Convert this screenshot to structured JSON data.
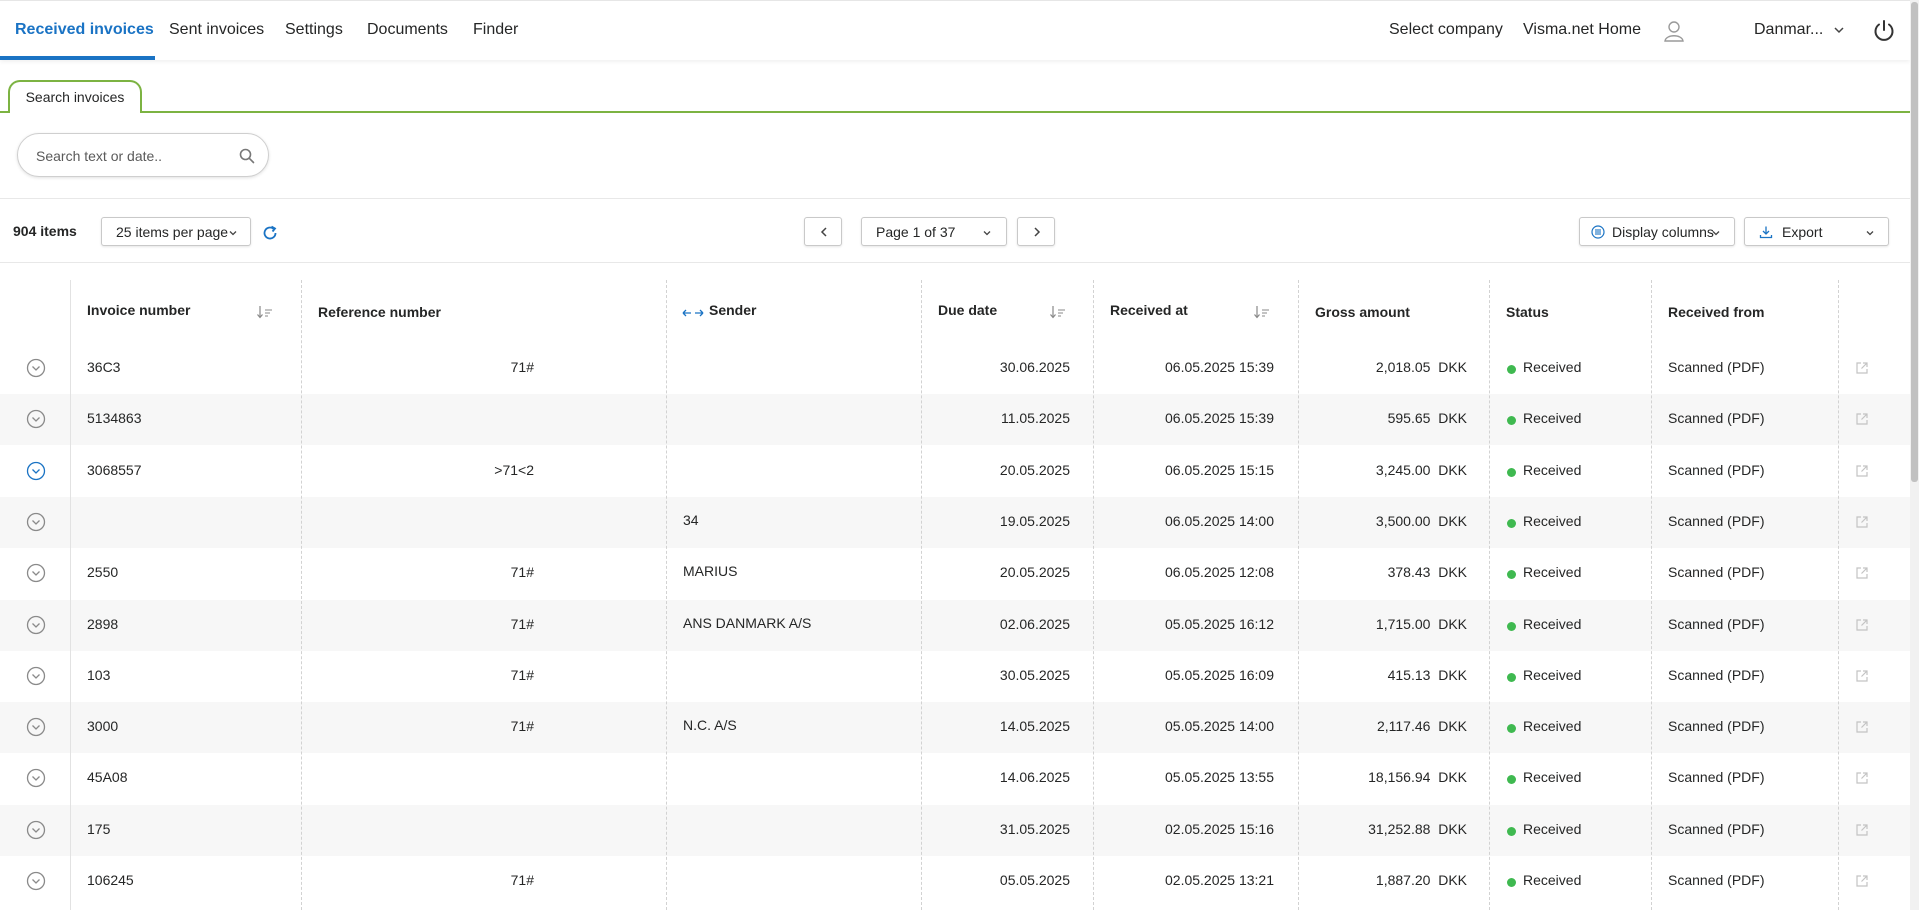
{
  "nav": {
    "left": [
      "Received invoices",
      "Sent invoices",
      "Settings",
      "Documents",
      "Finder"
    ],
    "select_company": "Select company",
    "home": "Visma.net Home",
    "country": "Danmar..."
  },
  "tab": {
    "label": "Search invoices"
  },
  "search": {
    "placeholder": "Search text or date.."
  },
  "toolbar": {
    "items_count": "904 items",
    "per_page": "25 items per page",
    "page_label": "Page 1 of 37",
    "display_columns": "Display columns",
    "export": "Export"
  },
  "columns": [
    "Invoice number",
    "Reference number",
    "Sender",
    "Due date",
    "Received at",
    "Gross amount",
    "Status",
    "Received from"
  ],
  "rows": [
    {
      "invoice": "36C3",
      "reference": "71#",
      "sender": "",
      "due": "30.06.2025",
      "received": "06.05.2025 15:39",
      "amount": "2,018.05",
      "currency": "DKK",
      "status": "Received",
      "from": "Scanned (PDF)",
      "expanded": false
    },
    {
      "invoice": "5134863",
      "reference": "",
      "sender": "",
      "due": "11.05.2025",
      "received": "06.05.2025 15:39",
      "amount": "595.65",
      "currency": "DKK",
      "status": "Received",
      "from": "Scanned (PDF)",
      "expanded": false
    },
    {
      "invoice": "3068557",
      "reference": ">71<2",
      "sender": "",
      "due": "20.05.2025",
      "received": "06.05.2025 15:15",
      "amount": "3,245.00",
      "currency": "DKK",
      "status": "Received",
      "from": "Scanned (PDF)",
      "expanded": true
    },
    {
      "invoice": "",
      "reference": "",
      "sender": "34",
      "due": "19.05.2025",
      "received": "06.05.2025 14:00",
      "amount": "3,500.00",
      "currency": "DKK",
      "status": "Received",
      "from": "Scanned (PDF)",
      "expanded": false
    },
    {
      "invoice": "2550",
      "reference": "71#",
      "sender": "MARIUS",
      "due": "20.05.2025",
      "received": "06.05.2025 12:08",
      "amount": "378.43",
      "currency": "DKK",
      "status": "Received",
      "from": "Scanned (PDF)",
      "expanded": false
    },
    {
      "invoice": "2898",
      "reference": "71#",
      "sender": "ANS DANMARK A/S",
      "due": "02.06.2025",
      "received": "05.05.2025 16:12",
      "amount": "1,715.00",
      "currency": "DKK",
      "status": "Received",
      "from": "Scanned (PDF)",
      "expanded": false
    },
    {
      "invoice": "103",
      "reference": "71#",
      "sender": "",
      "due": "30.05.2025",
      "received": "05.05.2025 16:09",
      "amount": "415.13",
      "currency": "DKK",
      "status": "Received",
      "from": "Scanned (PDF)",
      "expanded": false
    },
    {
      "invoice": "3000",
      "reference": "71#",
      "sender": "N.C. A/S",
      "due": "14.05.2025",
      "received": "05.05.2025 14:00",
      "amount": "2,117.46",
      "currency": "DKK",
      "status": "Received",
      "from": "Scanned (PDF)",
      "expanded": false
    },
    {
      "invoice": "45A08",
      "reference": "",
      "sender": "",
      "due": "14.06.2025",
      "received": "05.05.2025 13:55",
      "amount": "18,156.94",
      "currency": "DKK",
      "status": "Received",
      "from": "Scanned (PDF)",
      "expanded": false
    },
    {
      "invoice": "175",
      "reference": "",
      "sender": "",
      "due": "31.05.2025",
      "received": "02.05.2025 15:16",
      "amount": "31,252.88",
      "currency": "DKK",
      "status": "Received",
      "from": "Scanned (PDF)",
      "expanded": false
    },
    {
      "invoice": "106245",
      "reference": "71#",
      "sender": "",
      "due": "05.05.2025",
      "received": "02.05.2025 13:21",
      "amount": "1,887.20",
      "currency": "DKK",
      "status": "Received",
      "from": "Scanned (PDF)",
      "expanded": false
    }
  ],
  "colors": {
    "accent": "#1a73c4",
    "tab_green": "#7cb342",
    "status_green": "#3fb950"
  }
}
